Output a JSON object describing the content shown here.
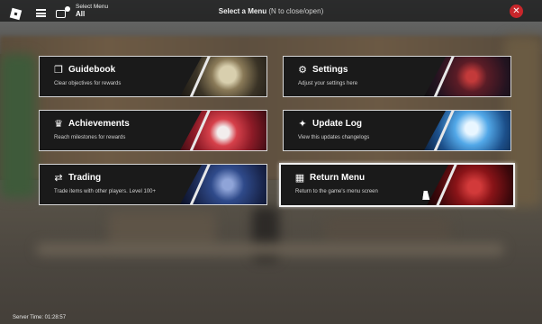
{
  "topbar": {
    "select_menu_label": "Select Menu",
    "select_menu_value": "All",
    "title": "Select a Menu",
    "title_hint": "(N to close/open)",
    "close_symbol": "✕"
  },
  "menu": [
    {
      "key": "guidebook",
      "icon": "book-icon",
      "glyph": "❐",
      "name": "Guidebook",
      "desc": "Clear objectives for rewards"
    },
    {
      "key": "settings",
      "icon": "gear-icon",
      "glyph": "⚙",
      "name": "Settings",
      "desc": "Adjust your settings here"
    },
    {
      "key": "achievements",
      "icon": "trophy-icon",
      "glyph": "♛",
      "name": "Achievements",
      "desc": "Reach milestones for rewards"
    },
    {
      "key": "update_log",
      "icon": "sparkle-icon",
      "glyph": "✦",
      "name": "Update Log",
      "desc": "View this updates changelogs"
    },
    {
      "key": "trading",
      "icon": "swap-arrows-icon",
      "glyph": "⇄",
      "name": "Trading",
      "desc": "Trade items with other players. Level 100+"
    },
    {
      "key": "return_menu",
      "icon": "grid-icon",
      "glyph": "▦",
      "name": "Return Menu",
      "desc": "Return to the game's menu screen"
    }
  ],
  "footer": {
    "server_time": "Server Time: 01:28:57"
  },
  "colors": {
    "close_red": "#c8262b",
    "card_bg": "#1a1a1a",
    "card_border": "#d9d9d9"
  }
}
